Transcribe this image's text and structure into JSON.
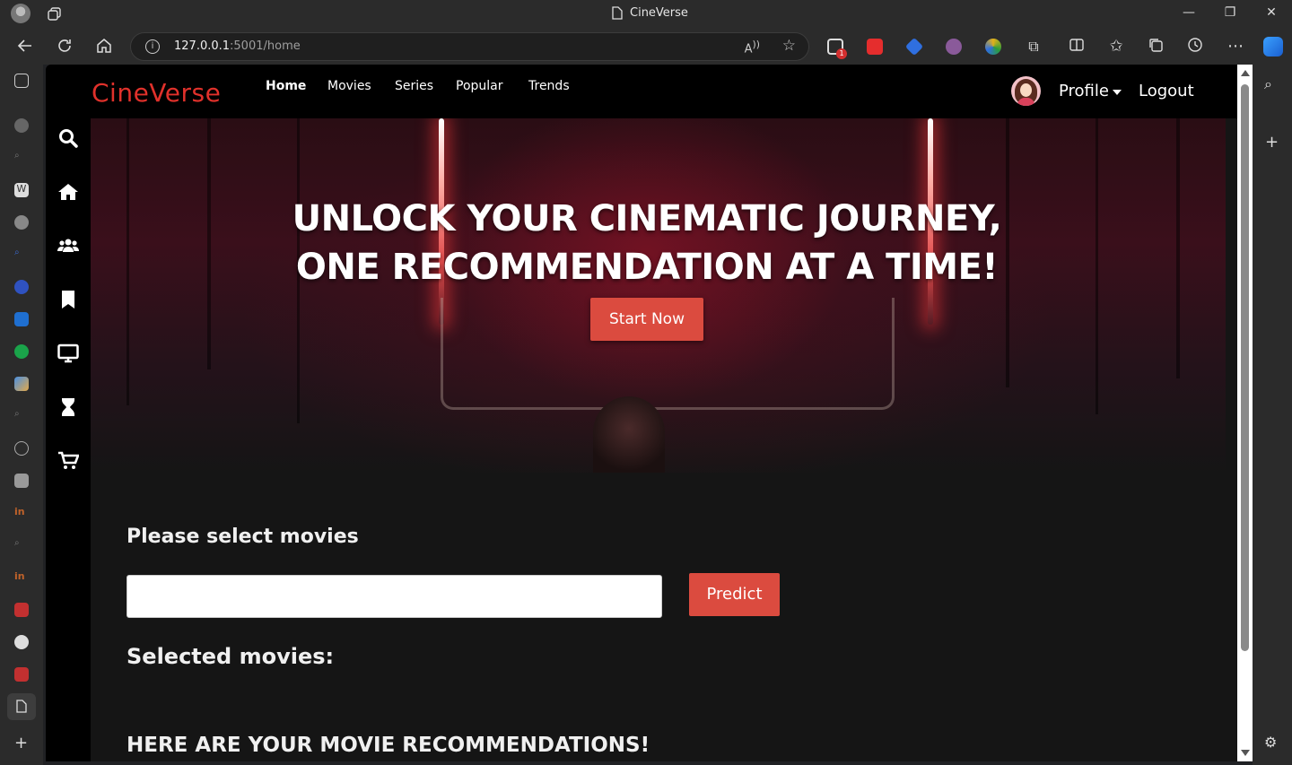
{
  "browser": {
    "tab_title": "CineVerse",
    "url_host": "127.0.0.1",
    "url_rest": ":5001/home",
    "win_minimize": "—",
    "win_restore": "❐",
    "win_close": "✕",
    "ext_badge_count": "1"
  },
  "app": {
    "brand": "CineVerse",
    "nav": {
      "home": "Home",
      "movies": "Movies",
      "series": "Series",
      "popular": "Popular",
      "trends": "Trends"
    },
    "profile": "Profile",
    "logout": "Logout",
    "accent_color": "#db4b3f",
    "brand_color": "#e0312b"
  },
  "sidebar_icons": [
    "search-icon",
    "home-icon",
    "users-icon",
    "bookmark-icon",
    "tv-icon",
    "hourglass-icon",
    "cart-icon"
  ],
  "hero": {
    "title_line1": "Unlock your cinematic journey,",
    "title_line2": "one recommendation at a time!",
    "cta": "Start Now"
  },
  "form": {
    "select_label": "Please select movies",
    "input_value": "",
    "predict": "Predict",
    "selected_label": "Selected movies:",
    "recs_heading": "HERE ARE YOUR MOVIE RECOMMENDATIONS!"
  }
}
